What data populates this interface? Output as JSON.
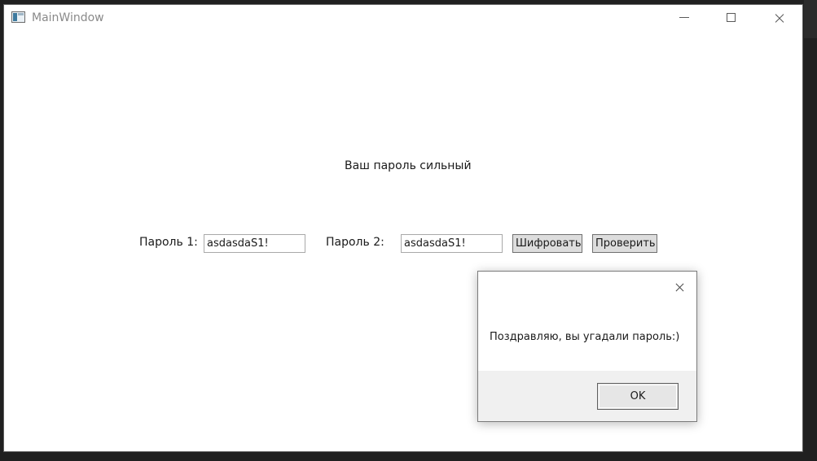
{
  "window": {
    "title": "MainWindow"
  },
  "main": {
    "status_text": "Ваш пароль сильный",
    "password1_label": "Пароль 1:",
    "password1_value": "asdasdaS1!",
    "password2_label": "Пароль 2:",
    "password2_value": "asdasdaS1!",
    "encrypt_button": "Шифровать",
    "check_button": "Проверить"
  },
  "dialog": {
    "message": "Поздравляю, вы угадали пароль:)",
    "ok_button": "OK"
  },
  "icons": {
    "app": "app-window-icon",
    "minimize": "minimize-icon",
    "maximize": "maximize-icon",
    "close": "close-icon",
    "dialog_close": "close-icon"
  }
}
